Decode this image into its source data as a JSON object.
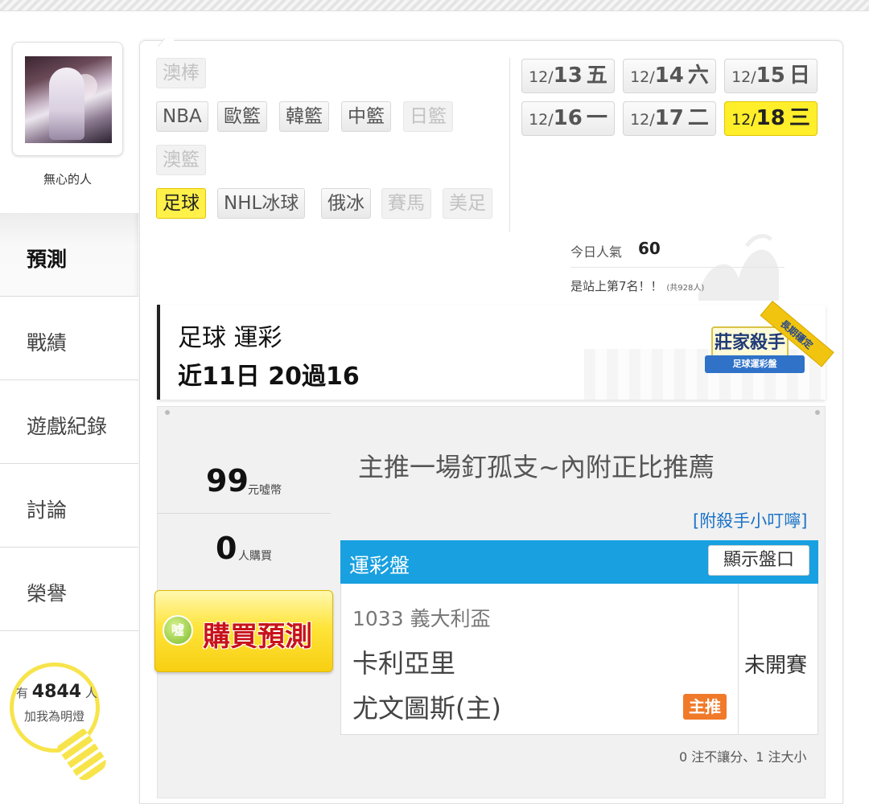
{
  "user": {
    "name": "無心的人"
  },
  "nav": [
    {
      "label": "預測",
      "active": true
    },
    {
      "label": "戰績"
    },
    {
      "label": "遊戲紀錄"
    },
    {
      "label": "討論"
    },
    {
      "label": "榮譽"
    }
  ],
  "fans": {
    "prefix": "有",
    "count": "4844",
    "unit": "人",
    "action": "加我為明燈"
  },
  "sports": [
    {
      "label": "澳棒",
      "state": "dim"
    },
    {
      "label": "NBA",
      "state": "normal"
    },
    {
      "label": "歐籃",
      "state": "normal"
    },
    {
      "label": "韓籃",
      "state": "normal"
    },
    {
      "label": "中籃",
      "state": "normal"
    },
    {
      "label": "日籃",
      "state": "dim"
    },
    {
      "label": "澳籃",
      "state": "dim"
    },
    {
      "label": "足球",
      "state": "selected"
    },
    {
      "label": "NHL冰球",
      "state": "normal"
    },
    {
      "label": "俄冰",
      "state": "normal"
    },
    {
      "label": "賽馬",
      "state": "dim"
    },
    {
      "label": "美足",
      "state": "dim"
    }
  ],
  "dates": [
    {
      "month": "12/",
      "day": "13",
      "weekday": "五"
    },
    {
      "month": "12/",
      "day": "14",
      "weekday": "六"
    },
    {
      "month": "12/",
      "day": "15",
      "weekday": "日"
    },
    {
      "month": "12/",
      "day": "16",
      "weekday": "一"
    },
    {
      "month": "12/",
      "day": "17",
      "weekday": "二"
    },
    {
      "month": "12/",
      "day": "18",
      "weekday": "三",
      "selected": true
    }
  ],
  "popularity": {
    "label": "今日人氣",
    "value": "60",
    "rank_text": "是站上第7名！！",
    "rank_note": "(共928人)"
  },
  "header": {
    "line1": "足球 運彩",
    "line2": "近11日 20過16"
  },
  "badge": {
    "title": "莊家殺手",
    "subtitle": "足球運彩盤",
    "ribbon": "長期穩定"
  },
  "offer": {
    "price": "99",
    "price_unit": "元噓幣",
    "buyers": "0",
    "buyers_unit": "人購買",
    "buy_label": "購買預測",
    "buy_icon": "噓"
  },
  "prediction": {
    "title": "主推一場釘孤支~內附正比推薦",
    "tips_link": "[附殺手小叮嚀]"
  },
  "game": {
    "market": "運彩盤",
    "show_odds": "顯示盤口",
    "number": "1033",
    "league": "義大利盃",
    "team_away": "卡利亞里",
    "team_home": "尤文圖斯(主)",
    "pick_tag": "主推",
    "status": "未開賽"
  },
  "footnote": "0 注不讓分、1 注大小",
  "colors": {
    "accent_blue": "#18a0e0",
    "highlight_yellow": "#ffee2a",
    "pick_orange": "#f07a2a",
    "buy_red": "#c8121b"
  }
}
